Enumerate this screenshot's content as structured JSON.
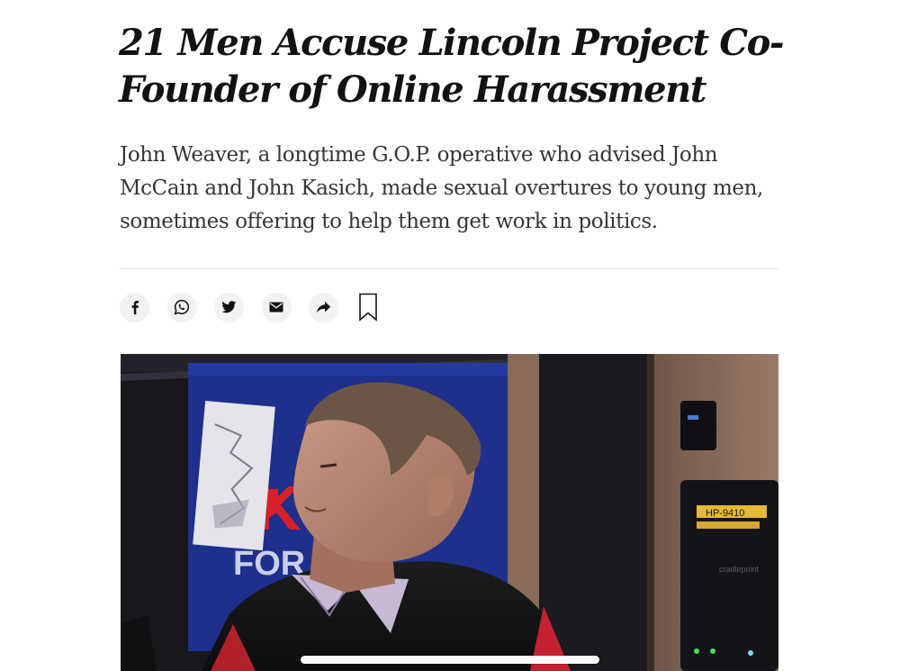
{
  "article": {
    "headline": "21 Men Accuse Lincoln Project Co-Founder of Online Harassment",
    "summary": "John Weaver, a longtime G.O.P. operative who advised John McCain and John Kasich, made sexual overtures to young men, sometimes offering to help them get work in politics."
  },
  "share": {
    "buttons": [
      {
        "name": "facebook",
        "icon": "facebook-icon"
      },
      {
        "name": "whatsapp",
        "icon": "whatsapp-icon"
      },
      {
        "name": "twitter",
        "icon": "twitter-icon"
      },
      {
        "name": "email",
        "icon": "email-icon"
      },
      {
        "name": "share",
        "icon": "share-arrow-icon"
      }
    ],
    "save_icon": "bookmark-icon"
  },
  "photo": {
    "sign_letters": "K",
    "sign_text": "FOR",
    "device_label": "HP-9410",
    "device_brand": "cradlepoint"
  },
  "colors": {
    "headline": "#121212",
    "summary": "#363636",
    "icon_bg": "#f2f2f2",
    "divider": "#dfdfdf",
    "sign_blue": "#1e2f8c",
    "sign_red": "#d8202a"
  }
}
